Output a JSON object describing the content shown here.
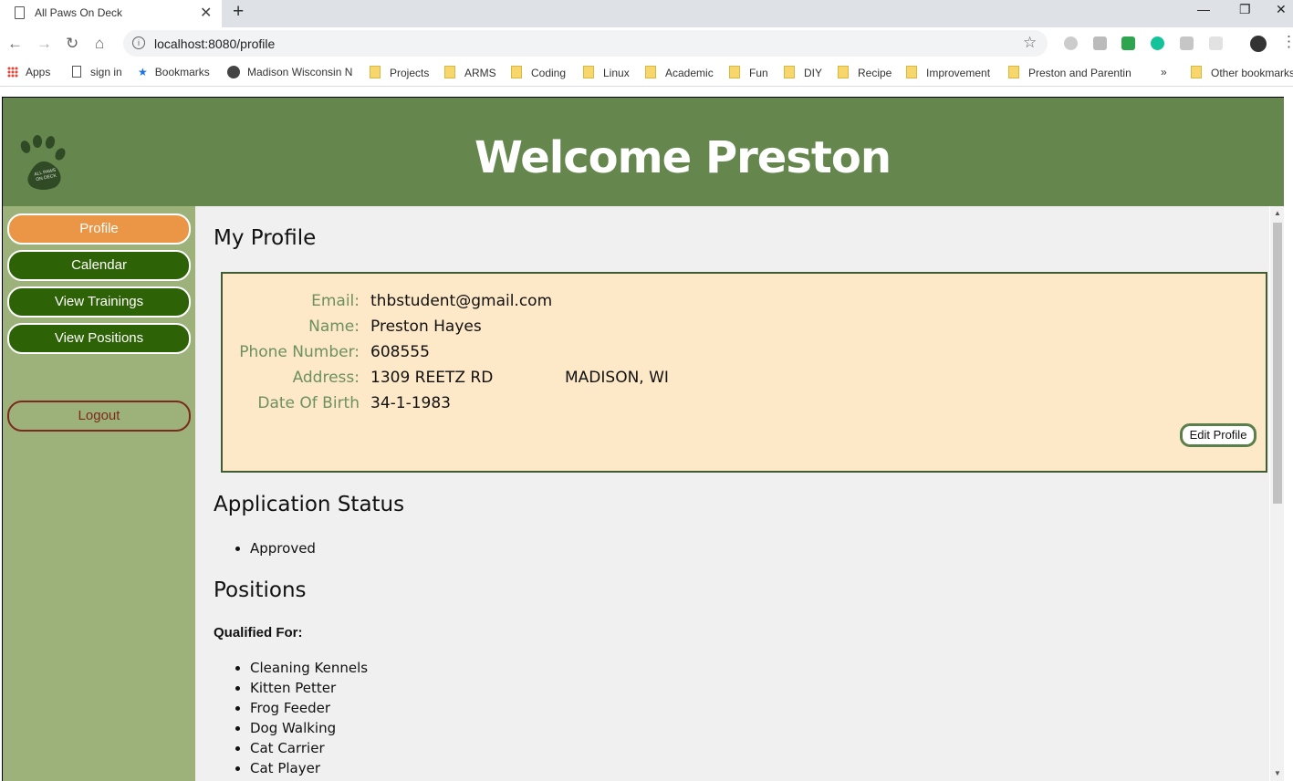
{
  "browser": {
    "tab_title": "All Paws On Deck",
    "tab_close": "✕",
    "new_tab": "+",
    "win_minimize": "—",
    "win_restore": "❐",
    "win_close": "✕",
    "url": "localhost:8080/profile"
  },
  "bookmarks": [
    "Apps",
    "sign in",
    "Bookmarks",
    "Madison Wisconsin N",
    "Projects",
    "ARMS",
    "Coding",
    "Linux",
    "Academic",
    "Fun",
    "DIY",
    "Recipe",
    "Improvement",
    "Preston and Parentin",
    "»",
    "Other bookmarks"
  ],
  "header": {
    "welcome": "Welcome Preston",
    "logo_text": "ALL PAWS ON DECK"
  },
  "nav": {
    "items": [
      {
        "label": "Profile",
        "active": true
      },
      {
        "label": "Calendar",
        "active": false
      },
      {
        "label": "View Trainings",
        "active": false
      },
      {
        "label": "View Positions",
        "active": false
      }
    ],
    "logout": "Logout"
  },
  "profile": {
    "heading": "My Profile",
    "fields": [
      {
        "label": "Email:",
        "value": "thbstudent@gmail.com"
      },
      {
        "label": "Name:",
        "value": "Preston Hayes"
      },
      {
        "label": "Phone Number:",
        "value": "608555"
      },
      {
        "label": "Address:",
        "value": "1309 REETZ RD",
        "value2": "MADISON, WI"
      },
      {
        "label": "Date Of Birth",
        "value": "34-1-1983"
      }
    ],
    "edit_button": "Edit Profile"
  },
  "application": {
    "heading": "Application Status",
    "items": [
      "Approved"
    ]
  },
  "positions": {
    "heading": "Positions",
    "subheading": "Qualified For:",
    "items": [
      "Cleaning Kennels",
      "Kitten Petter",
      "Frog Feeder",
      "Dog Walking",
      "Cat Carrier",
      "Cat Player"
    ]
  },
  "colors": {
    "header_green": "#65874e",
    "sidebar_green": "#9cb27a",
    "nav_dark_green": "#2e6206",
    "active_orange": "#ea9646",
    "card_bg": "#fde8c8"
  }
}
